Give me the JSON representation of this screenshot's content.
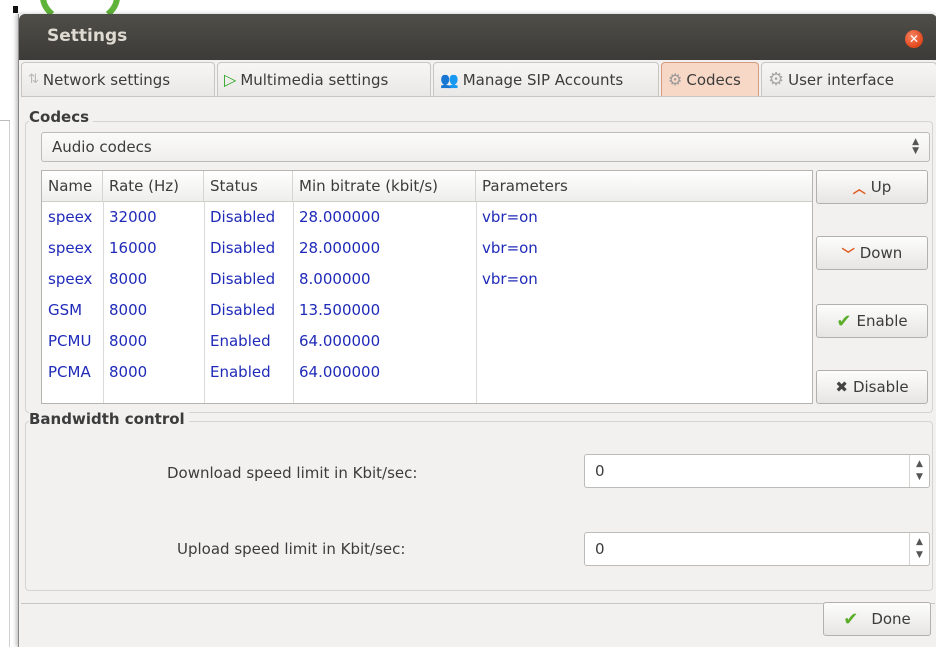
{
  "window": {
    "title": "Settings"
  },
  "tabs": [
    {
      "label": "Network settings",
      "icon": "network-icon"
    },
    {
      "label": "Multimedia settings",
      "icon": "play-icon"
    },
    {
      "label": "Manage SIP Accounts",
      "icon": "accounts-icon"
    },
    {
      "label": "Codecs",
      "icon": "gears-icon",
      "active": true
    },
    {
      "label": "User interface",
      "icon": "gear-icon"
    }
  ],
  "codecs": {
    "group_label": "Codecs",
    "selector": {
      "selected": "Audio codecs"
    },
    "table": {
      "headers": [
        "Name",
        "Rate (Hz)",
        "Status",
        "Min bitrate (kbit/s)",
        "Parameters"
      ],
      "rows": [
        [
          "speex",
          "32000",
          "Disabled",
          "28.000000",
          "vbr=on"
        ],
        [
          "speex",
          "16000",
          "Disabled",
          "28.000000",
          "vbr=on"
        ],
        [
          "speex",
          "8000",
          "Disabled",
          "8.000000",
          "vbr=on"
        ],
        [
          "GSM",
          "8000",
          "Disabled",
          "13.500000",
          ""
        ],
        [
          "PCMU",
          "8000",
          "Enabled",
          "64.000000",
          ""
        ],
        [
          "PCMA",
          "8000",
          "Enabled",
          "64.000000",
          ""
        ]
      ]
    },
    "buttons": {
      "up": "Up",
      "down": "Down",
      "enable": "Enable",
      "disable": "Disable"
    }
  },
  "bandwidth": {
    "group_label": "Bandwidth control",
    "download_label": "Download speed limit in Kbit/sec:",
    "download_value": "0",
    "upload_label": "Upload speed limit in Kbit/sec:",
    "upload_value": "0"
  },
  "footer": {
    "done_label": "Done"
  },
  "colors": {
    "accent_tab": "#f7d7c5",
    "table_text": "#1f2ab8",
    "titlebar": "#3c3b37",
    "close": "#e0461c"
  }
}
